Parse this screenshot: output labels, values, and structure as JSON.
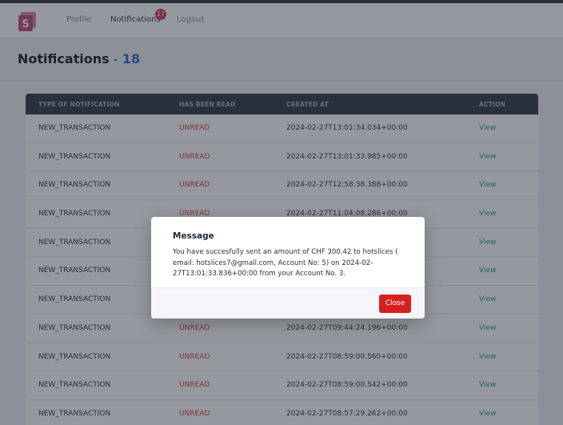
{
  "nav": {
    "profile": "Profile",
    "notifications": "Notifications",
    "notifications_badge": "17",
    "logout": "Logout"
  },
  "page": {
    "title": "Notifications",
    "separator": "-",
    "count": "18"
  },
  "table": {
    "headers": [
      "TYPE OF NOTIFICATION",
      "HAS BEEN READ",
      "CREATED AT",
      "ACTION"
    ],
    "rows": [
      {
        "type": "NEW_TRANSACTION",
        "read": "UNREAD",
        "created": "2024-02-27T13:01:34.034+00:00",
        "action": "View"
      },
      {
        "type": "NEW_TRANSACTION",
        "read": "UNREAD",
        "created": "2024-02-27T13:01:33.985+00:00",
        "action": "View"
      },
      {
        "type": "NEW_TRANSACTION",
        "read": "UNREAD",
        "created": "2024-02-27T12:58:38.388+00:00",
        "action": "View"
      },
      {
        "type": "NEW_TRANSACTION",
        "read": "UNREAD",
        "created": "2024-02-27T11:04:08.286+00:00",
        "action": "View"
      },
      {
        "type": "NEW_TRANSACTION",
        "read": "",
        "created": "",
        "action": "View"
      },
      {
        "type": "NEW_TRANSACTION",
        "read": "",
        "created": "",
        "action": "View"
      },
      {
        "type": "NEW_TRANSACTION",
        "read": "",
        "created": "",
        "action": "View"
      },
      {
        "type": "NEW_TRANSACTION",
        "read": "UNREAD",
        "created": "2024-02-27T09:44:24.196+00:00",
        "action": "View"
      },
      {
        "type": "NEW_TRANSACTION",
        "read": "UNREAD",
        "created": "2024-02-27T08:59:00.560+00:00",
        "action": "View"
      },
      {
        "type": "NEW_TRANSACTION",
        "read": "UNREAD",
        "created": "2024-02-27T08:59:00.542+00:00",
        "action": "View"
      },
      {
        "type": "NEW_TRANSACTION",
        "read": "UNREAD",
        "created": "2024-02-27T08:57:29.262+00:00",
        "action": "View"
      }
    ]
  },
  "modal": {
    "title": "Message",
    "body": "You have succesfully sent an amount of CHF 300.42 to hotslices ( email: hotslices7@gmail.com, Account No: 5) on 2024-02-27T13:01:33.836+00:00 from your Account No. 3.",
    "close_label": "Close"
  },
  "colors": {
    "logo": "#c2527a",
    "header": "#3c4250",
    "unread": "#d14a5a",
    "view_link": "#3aa38a",
    "count": "#3b6fd8",
    "close_button": "#d62020"
  }
}
